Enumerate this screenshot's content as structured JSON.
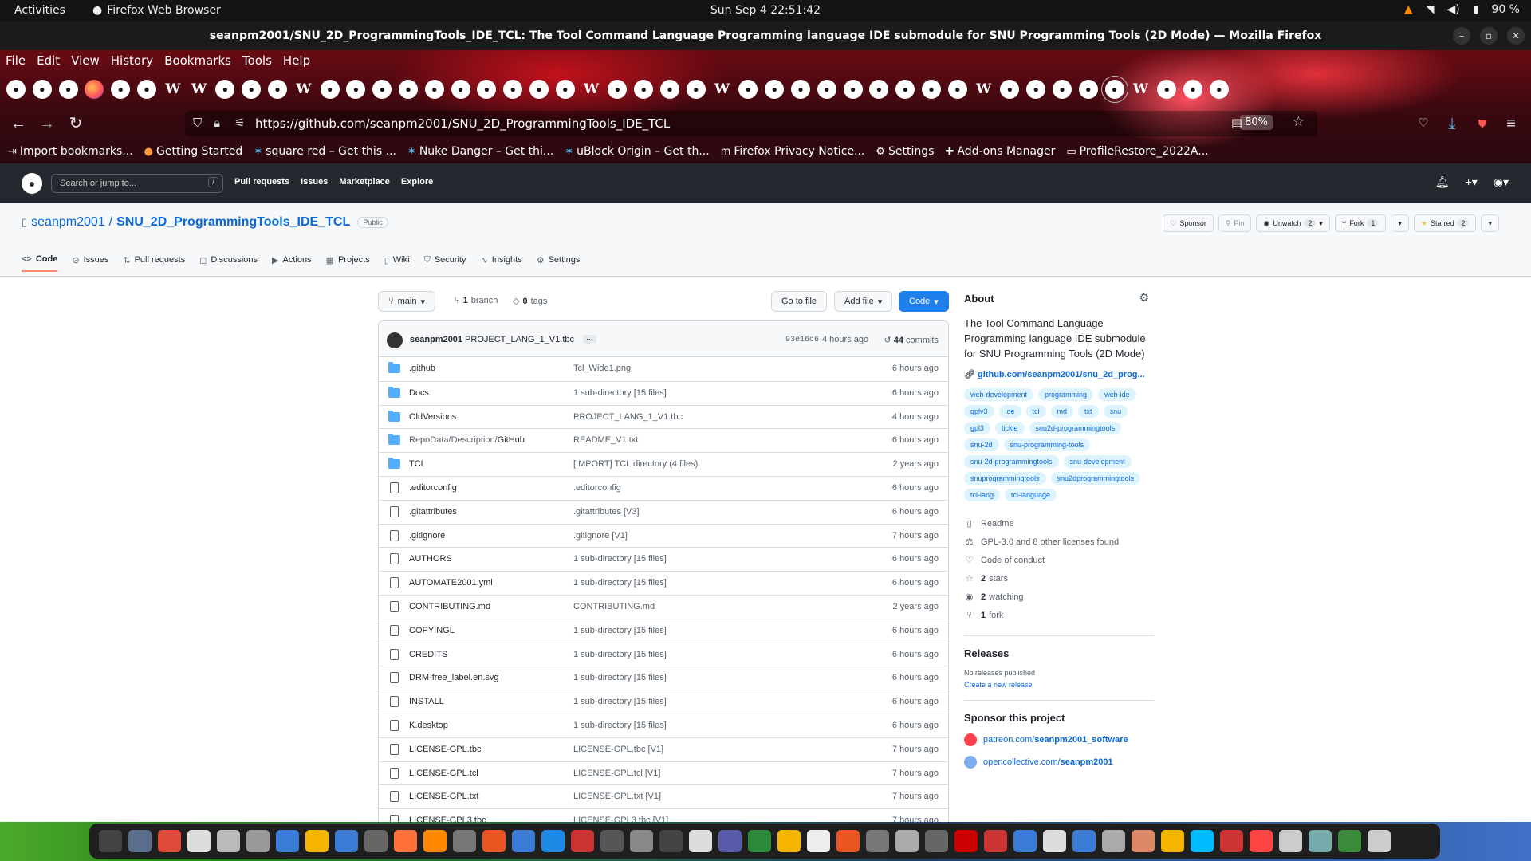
{
  "system": {
    "activities": "Activities",
    "app_name": "Firefox Web Browser",
    "clock": "Sun Sep 4  22:51:42",
    "battery": "90 %"
  },
  "window": {
    "title": "seanpm2001/SNU_2D_ProgrammingTools_IDE_TCL: The Tool Command Language Programming language IDE submodule for SNU Programming Tools (2D Mode) — Mozilla Firefox"
  },
  "menu": [
    "File",
    "Edit",
    "View",
    "History",
    "Bookmarks",
    "Tools",
    "Help"
  ],
  "tabs": [
    "github",
    "github",
    "github",
    "firefox",
    "github",
    "github",
    "wiki",
    "wiki",
    "github",
    "github",
    "github",
    "wiki",
    "github",
    "github",
    "github",
    "github",
    "github",
    "github",
    "github",
    "github",
    "github",
    "github",
    "wiki",
    "github",
    "github",
    "github",
    "github",
    "wiki",
    "github",
    "github",
    "github",
    "github",
    "github",
    "github",
    "github",
    "github",
    "github",
    "wiki",
    "github",
    "github",
    "github",
    "github",
    "active",
    "wiki",
    "github",
    "github",
    "github"
  ],
  "address": {
    "url": "https://github.com/seanpm2001/SNU_2D_ProgrammingTools_IDE_TCL",
    "zoom": "80%"
  },
  "bookmarks": [
    {
      "icon": "import-icon",
      "label": "Import bookmarks..."
    },
    {
      "icon": "firefox-icon",
      "label": "Getting Started"
    },
    {
      "icon": "addon-icon",
      "label": "square red – Get this ..."
    },
    {
      "icon": "addon-icon",
      "label": "Nuke Danger – Get thi..."
    },
    {
      "icon": "addon-icon",
      "label": "uBlock Origin – Get th..."
    },
    {
      "icon": "mozilla-icon",
      "label": "Firefox Privacy Notice..."
    },
    {
      "icon": "gear-icon",
      "label": "Settings"
    },
    {
      "icon": "puzzle-icon",
      "label": "Add-ons Manager"
    },
    {
      "icon": "folder-icon",
      "label": "ProfileRestore_2022A..."
    }
  ],
  "gh_header": {
    "search_placeholder": "Search or jump to...",
    "slash": "/",
    "nav": [
      "Pull requests",
      "Issues",
      "Marketplace",
      "Explore"
    ]
  },
  "repo": {
    "owner": "seanpm2001",
    "separator": "/",
    "name": "SNU_2D_ProgrammingTools_IDE_TCL",
    "visibility": "Public",
    "sponsor": "Sponsor",
    "pin": "Pin",
    "unwatch": "Unwatch",
    "unwatch_count": "2",
    "fork": "Fork",
    "fork_count": "1",
    "starred": "Starred",
    "star_count": "2",
    "tabs": [
      {
        "icon": "<>",
        "label": "Code"
      },
      {
        "icon": "⊙",
        "label": "Issues"
      },
      {
        "icon": "⇅",
        "label": "Pull requests"
      },
      {
        "icon": "◻",
        "label": "Discussions"
      },
      {
        "icon": "▶",
        "label": "Actions"
      },
      {
        "icon": "▦",
        "label": "Projects"
      },
      {
        "icon": "▯",
        "label": "Wiki"
      },
      {
        "icon": "⛉",
        "label": "Security"
      },
      {
        "icon": "∿",
        "label": "Insights"
      },
      {
        "icon": "⚙",
        "label": "Settings"
      }
    ]
  },
  "toolbar": {
    "branch": "main",
    "branches_count": "1",
    "branches_label": "branch",
    "tags_count": "0",
    "tags_label": "tags",
    "goto_file": "Go to file",
    "add_file": "Add file",
    "code": "Code"
  },
  "commit": {
    "author": "seanpm2001",
    "message": "PROJECT_LANG_1_V1.tbc",
    "dots": "···",
    "sha": "93e16c6",
    "ago": "4 hours ago",
    "count": "44",
    "count_label": "commits"
  },
  "files": [
    {
      "type": "dir",
      "name": ".github",
      "message": "Tcl_Wide1.png",
      "age": "6 hours ago"
    },
    {
      "type": "dir",
      "name": "Docs",
      "message": "1 sub-directory [15 files]",
      "age": "6 hours ago"
    },
    {
      "type": "dir",
      "name": "OldVersions",
      "message": "PROJECT_LANG_1_V1.tbc",
      "age": "4 hours ago"
    },
    {
      "type": "dir",
      "name_prefix": "RepoData/Description/",
      "name": "GitHub",
      "message": "README_V1.txt",
      "age": "6 hours ago"
    },
    {
      "type": "dir",
      "name": "TCL",
      "message": "[IMPORT] TCL directory (4 files)",
      "age": "2 years ago"
    },
    {
      "type": "file",
      "name": ".editorconfig",
      "message": ".editorconfig",
      "age": "6 hours ago"
    },
    {
      "type": "file",
      "name": ".gitattributes",
      "message": ".gitattributes [V3]",
      "age": "6 hours ago"
    },
    {
      "type": "file",
      "name": ".gitignore",
      "message": ".gitignore [V1]",
      "age": "7 hours ago"
    },
    {
      "type": "file",
      "name": "AUTHORS",
      "message": "1 sub-directory [15 files]",
      "age": "6 hours ago"
    },
    {
      "type": "file",
      "name": "AUTOMATE2001.yml",
      "message": "1 sub-directory [15 files]",
      "age": "6 hours ago"
    },
    {
      "type": "file",
      "name": "CONTRIBUTING.md",
      "message": "CONTRIBUTING.md",
      "age": "2 years ago"
    },
    {
      "type": "file",
      "name": "COPYINGL",
      "message": "1 sub-directory [15 files]",
      "age": "6 hours ago"
    },
    {
      "type": "file",
      "name": "CREDITS",
      "message": "1 sub-directory [15 files]",
      "age": "6 hours ago"
    },
    {
      "type": "file",
      "name": "DRM-free_label.en.svg",
      "message": "1 sub-directory [15 files]",
      "age": "6 hours ago"
    },
    {
      "type": "file",
      "name": "INSTALL",
      "message": "1 sub-directory [15 files]",
      "age": "6 hours ago"
    },
    {
      "type": "file",
      "name": "K.desktop",
      "message": "1 sub-directory [15 files]",
      "age": "6 hours ago"
    },
    {
      "type": "file",
      "name": "LICENSE-GPL.tbc",
      "message": "LICENSE-GPL.tbc [V1]",
      "age": "7 hours ago"
    },
    {
      "type": "file",
      "name": "LICENSE-GPL.tcl",
      "message": "LICENSE-GPL.tcl [V1]",
      "age": "7 hours ago"
    },
    {
      "type": "file",
      "name": "LICENSE-GPL.txt",
      "message": "LICENSE-GPL.txt [V1]",
      "age": "7 hours ago"
    },
    {
      "type": "file",
      "name": "LICENSE-GPL3.tbc",
      "message": "LICENSE-GPL3.tbc [V1]",
      "age": "7 hours ago"
    }
  ],
  "about": {
    "heading": "About",
    "description": "The Tool Command Language Programming language IDE submodule for SNU Programming Tools (2D Mode)",
    "website": "github.com/seanpm2001/snu_2d_prog...",
    "topics": [
      "web-development",
      "programming",
      "web-ide",
      "gplv3",
      "ide",
      "tcl",
      "md",
      "txt",
      "snu",
      "gpl3",
      "tickle",
      "snu2d-programmingtools",
      "snu-2d",
      "snu-programming-tools",
      "snu-2d-programmingtools",
      "snu-development",
      "snuprogrammingtools",
      "snu2dprogrammingtools",
      "tcl-lang",
      "tcl-language"
    ],
    "stats": [
      {
        "icon": "▯",
        "bold": "",
        "text": "Readme"
      },
      {
        "icon": "⚖",
        "bold": "",
        "text": "GPL-3.0 and 8 other licenses found"
      },
      {
        "icon": "♡",
        "bold": "",
        "text": "Code of conduct"
      },
      {
        "icon": "☆",
        "bold": "2",
        "text": "stars"
      },
      {
        "icon": "◉",
        "bold": "2",
        "text": "watching"
      },
      {
        "icon": "⑂",
        "bold": "1",
        "text": "fork"
      }
    ],
    "releases_heading": "Releases",
    "no_releases": "No releases published",
    "create_release": "Create a new release",
    "sponsor_heading": "Sponsor this project",
    "sponsors": [
      {
        "prefix": "patreon.com/",
        "handle": "seanpm2001_software",
        "color": "#ff424d"
      },
      {
        "prefix": "opencollective.com/",
        "handle": "seanpm2001",
        "color": "#7fadf2"
      }
    ]
  },
  "dock_icons": [
    "#444",
    "#5a6d8a",
    "#e04a3a",
    "#ddd",
    "#bbb",
    "#999",
    "#3a7bd5",
    "#f4b400",
    "#3a7bd5",
    "#666",
    "#ff7139",
    "#f80",
    "#777",
    "#e95420",
    "#3a7bd5",
    "#1e88e5",
    "#c33",
    "#555",
    "#888",
    "#444",
    "#ddd",
    "#5a5aaa",
    "#2a8a3a",
    "#f4b400",
    "#eee",
    "#e95420",
    "#777",
    "#aaa",
    "#666",
    "#c00",
    "#c33",
    "#3a7bd5",
    "#ddd",
    "#3a7bd5",
    "#aaa",
    "#d86",
    "#f4b400",
    "#0bf",
    "#c33",
    "#f44",
    "#ccc",
    "#7aa",
    "#3a8a3a",
    "#ccc"
  ]
}
